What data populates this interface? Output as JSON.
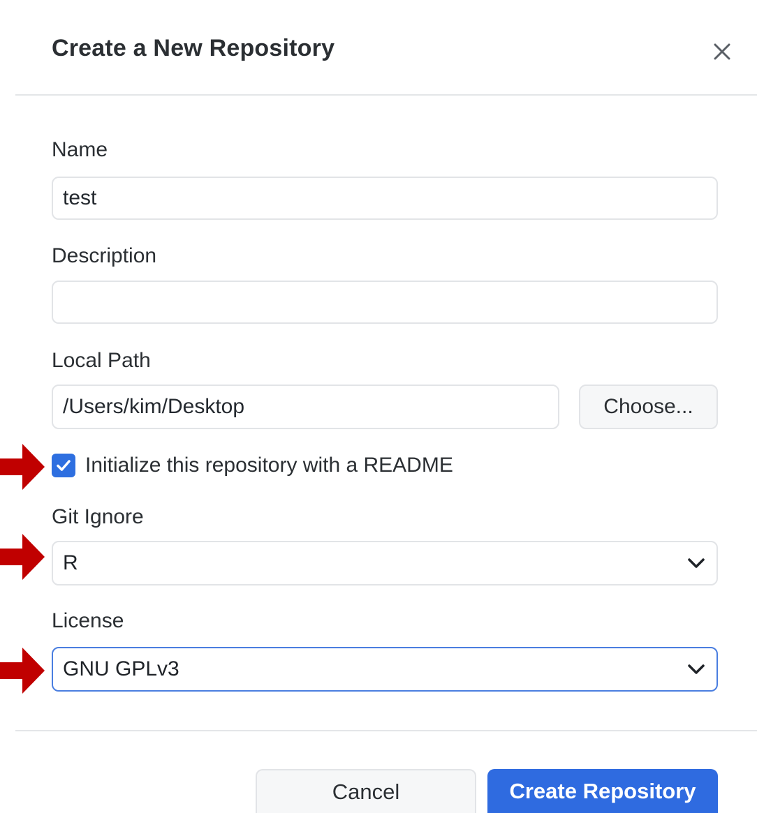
{
  "dialog": {
    "title": "Create a New Repository",
    "close_icon": "close-icon"
  },
  "form": {
    "name": {
      "label": "Name",
      "value": "test"
    },
    "description": {
      "label": "Description",
      "value": "",
      "placeholder": ""
    },
    "local_path": {
      "label": "Local Path",
      "value": "/Users/kim/Desktop",
      "choose_label": "Choose..."
    },
    "readme": {
      "label": "Initialize this repository with a README",
      "checked": true
    },
    "git_ignore": {
      "label": "Git Ignore",
      "selected": "R"
    },
    "license": {
      "label": "License",
      "selected": "GNU GPLv3"
    }
  },
  "footer": {
    "cancel_label": "Cancel",
    "create_label": "Create Repository"
  },
  "colors": {
    "accent": "#2f6be0",
    "annotation_arrow": "#c00000",
    "focus_border": "#4a7ee0"
  }
}
